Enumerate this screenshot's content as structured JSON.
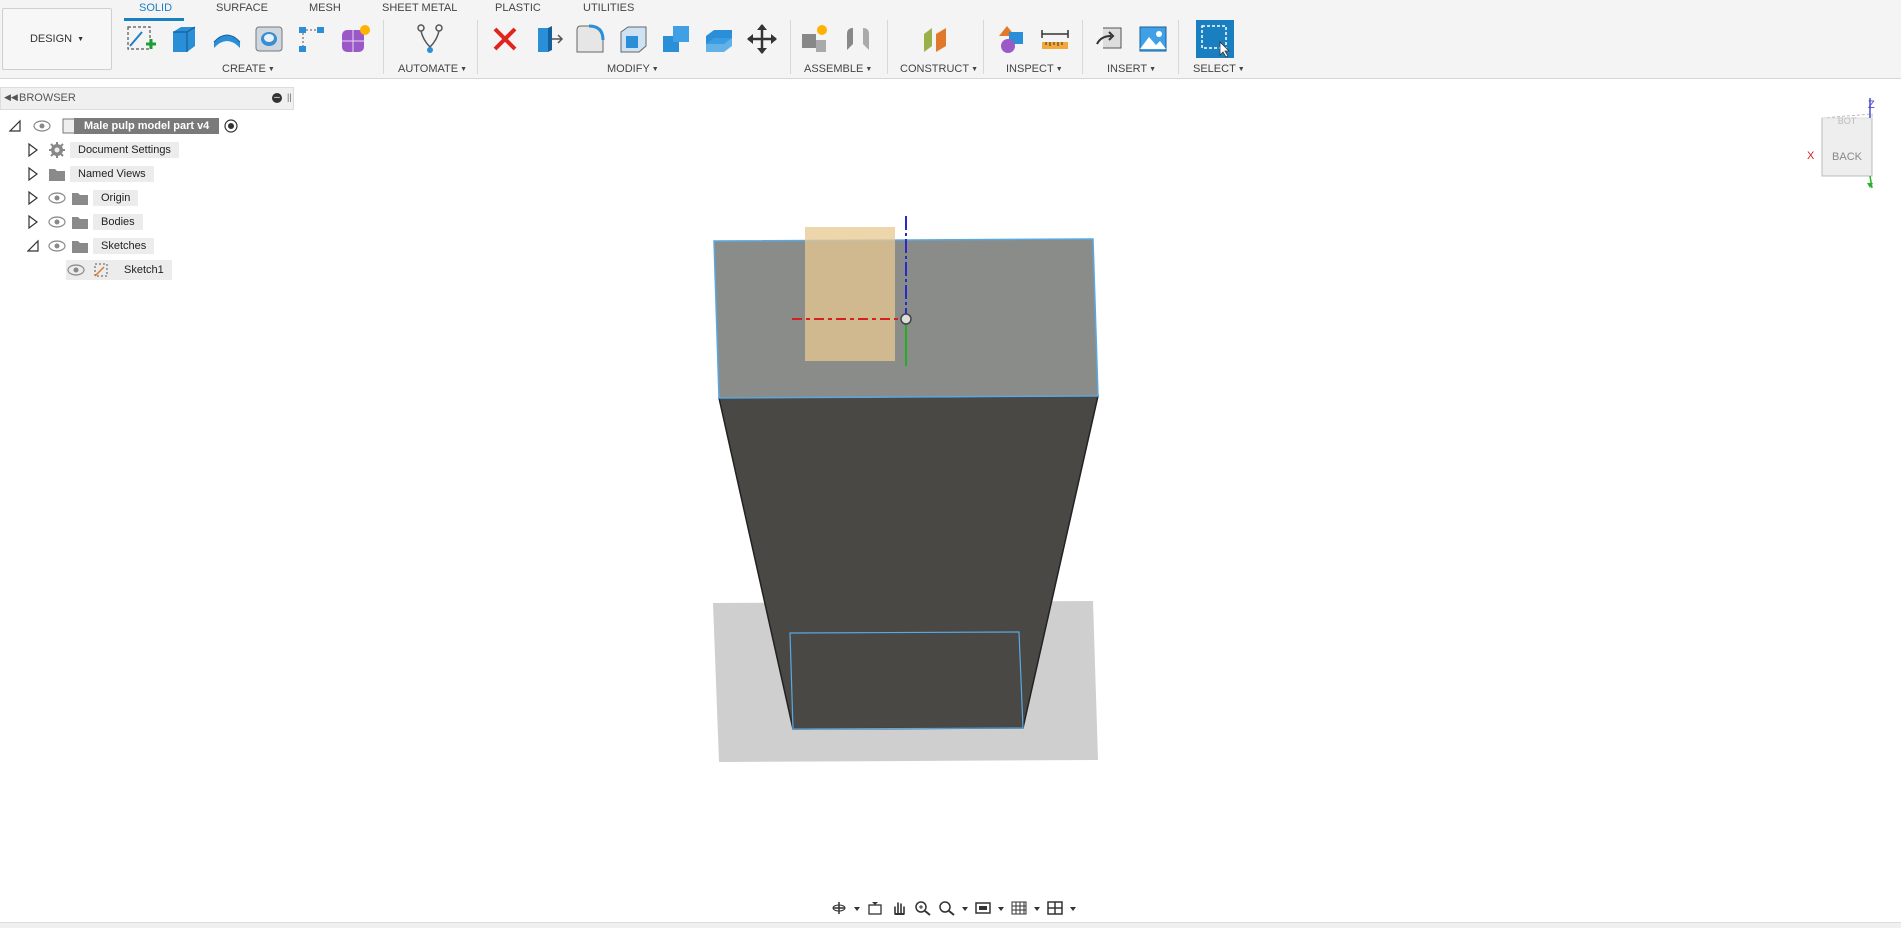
{
  "workspace": {
    "label": "DESIGN"
  },
  "tabs": [
    {
      "label": "SOLID",
      "active": true
    },
    {
      "label": "SURFACE",
      "active": false
    },
    {
      "label": "MESH",
      "active": false
    },
    {
      "label": "SHEET METAL",
      "active": false
    },
    {
      "label": "PLASTIC",
      "active": false
    },
    {
      "label": "UTILITIES",
      "active": false
    }
  ],
  "groups": {
    "create": "CREATE",
    "automate": "AUTOMATE",
    "modify": "MODIFY",
    "assemble": "ASSEMBLE",
    "construct": "CONSTRUCT",
    "inspect": "INSPECT",
    "insert": "INSERT",
    "select": "SELECT"
  },
  "tools": [
    {
      "name": "create-sketch-icon"
    },
    {
      "name": "extrude-icon"
    },
    {
      "name": "revolve-icon"
    },
    {
      "name": "hole-icon"
    },
    {
      "name": "pattern-icon"
    },
    {
      "name": "form-icon"
    },
    {
      "name": "automate-icon"
    },
    {
      "name": "delete-icon"
    },
    {
      "name": "press-pull-icon"
    },
    {
      "name": "fillet-icon"
    },
    {
      "name": "shell-icon"
    },
    {
      "name": "combine-icon"
    },
    {
      "name": "offset-face-icon"
    },
    {
      "name": "move-icon"
    },
    {
      "name": "new-component-icon"
    },
    {
      "name": "joint-icon"
    },
    {
      "name": "offset-plane-icon"
    },
    {
      "name": "interference-icon"
    },
    {
      "name": "measure-icon"
    },
    {
      "name": "insert-derive-icon"
    },
    {
      "name": "insert-image-icon"
    },
    {
      "name": "select-icon"
    }
  ],
  "browser": {
    "title": "BROWSER",
    "root": "Male pulp model part v4",
    "items": [
      {
        "label": "Document Settings"
      },
      {
        "label": "Named Views"
      },
      {
        "label": "Origin"
      },
      {
        "label": "Bodies"
      },
      {
        "label": "Sketches"
      },
      {
        "label": "Sketch1"
      }
    ]
  },
  "viewcube": {
    "face": "BACK",
    "top_face": "BOT",
    "axis_x": "X",
    "axis_z": "Z"
  },
  "colors": {
    "accent": "#1a7fc1",
    "body_top": "#8a8c8a",
    "body_side": "#4a4845",
    "sketch_profile": "#e8c890",
    "shadow": "#cfcfcf",
    "edge_highlight": "#5aa8e0"
  }
}
